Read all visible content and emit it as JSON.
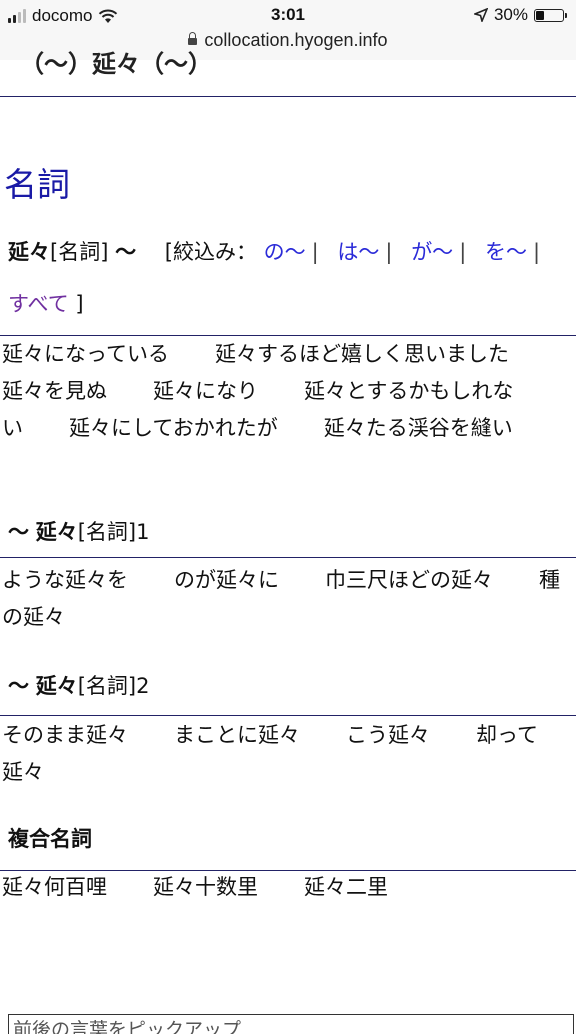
{
  "status": {
    "carrier": "docomo",
    "time": "3:01",
    "battery": "30%",
    "battery_level": 0.3
  },
  "url": "collocation.hyogen.info",
  "top_heading": "（〜）延々（〜）",
  "section": "名詞",
  "entry": {
    "word": "延々",
    "pos": "[名詞]",
    "tilde": "〜",
    "filter_prefix": "[絞込み：",
    "filters": [
      "の〜",
      "は〜",
      "が〜",
      "を〜"
    ],
    "filter_all": "すべて",
    "filter_suffix": "]"
  },
  "group_main": [
    "延々になっている",
    "延々するほど嬉しく思いました",
    "延々を見ぬ",
    "延々になり",
    "延々とするかもしれない",
    "延々にしておかれたが",
    "延々たる渓谷を縫い"
  ],
  "group1": {
    "tilde": "〜",
    "word": "延々",
    "pos": "[名詞]1",
    "items": [
      "ような延々を",
      "のが延々に",
      "巾三尺ほどの延々",
      "種の延々"
    ]
  },
  "group2": {
    "tilde": "〜",
    "word": "延々",
    "pos": "[名詞]2",
    "items": [
      "そのまま延々",
      "まことに延々",
      "こう延々",
      "却って延々"
    ]
  },
  "compound": {
    "title": "複合名詞",
    "items": [
      "延々何百哩",
      "延々十数里",
      "延々二里"
    ]
  },
  "footer": "前後の言葉をピックアップ"
}
